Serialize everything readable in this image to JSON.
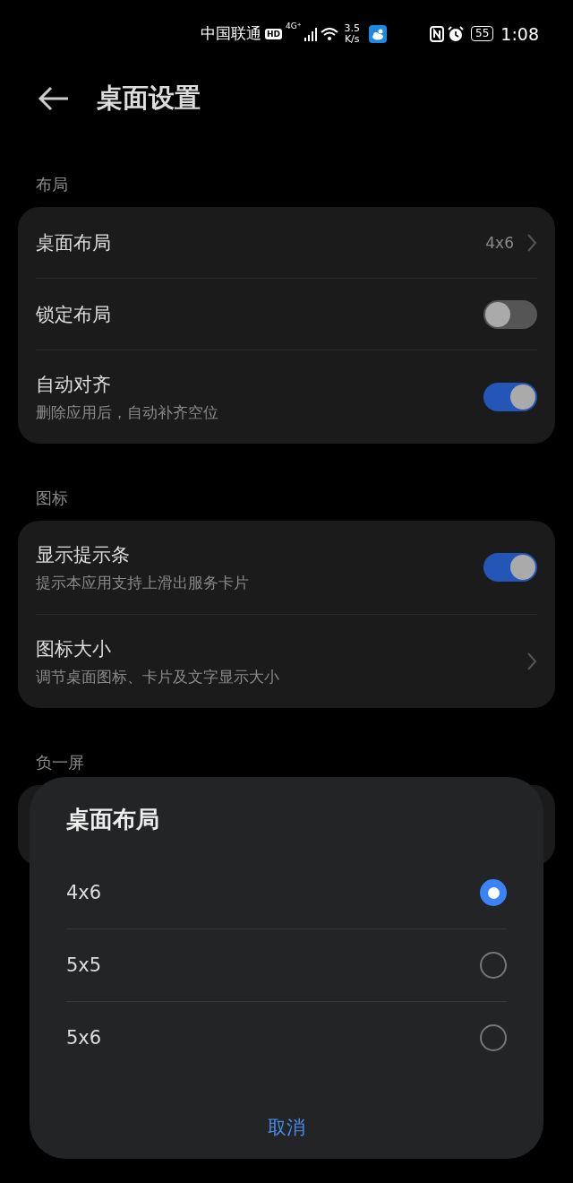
{
  "status_bar": {
    "carrier": "中国联通",
    "hd": "HD",
    "network": "4G⁺",
    "speed_value": "3.5",
    "speed_unit": "K/s",
    "battery": "55",
    "time": "1:08"
  },
  "header": {
    "title": "桌面设置"
  },
  "sections": [
    {
      "title": "布局",
      "items": [
        {
          "kind": "nav",
          "label": "桌面布局",
          "value": "4x6"
        },
        {
          "kind": "toggle",
          "label": "锁定布局",
          "on": false
        },
        {
          "kind": "toggle",
          "label": "自动对齐",
          "subtitle": "删除应用后，自动补齐空位",
          "on": true
        }
      ]
    },
    {
      "title": "图标",
      "items": [
        {
          "kind": "toggle",
          "label": "显示提示条",
          "subtitle": "提示本应用支持上滑出服务卡片",
          "on": true
        },
        {
          "kind": "nav",
          "label": "图标大小",
          "subtitle": "调节桌面图标、卡片及文字显示大小"
        }
      ]
    },
    {
      "title": "负一屏"
    }
  ],
  "dialog": {
    "title": "桌面布局",
    "options": [
      {
        "label": "4x6",
        "selected": true
      },
      {
        "label": "5x5",
        "selected": false
      },
      {
        "label": "5x6",
        "selected": false
      }
    ],
    "cancel": "取消"
  }
}
